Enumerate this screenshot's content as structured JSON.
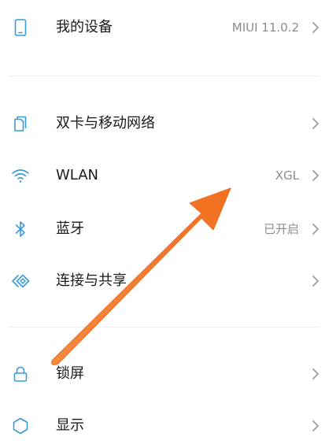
{
  "colors": {
    "icon": "#3a9bd6",
    "text": "#1a1a1a",
    "secondary": "#8c8c8c",
    "chevron": "#9a9a9a",
    "annotation_arrow": "#f47a2c"
  },
  "settings": {
    "my_device": {
      "label": "我的设备",
      "value": "MIUI 11.0.2",
      "icon": "phone-icon"
    },
    "dual_sim": {
      "label": "双卡与移动网络",
      "icon": "sim-card-icon"
    },
    "wlan": {
      "label": "WLAN",
      "value": "XGL",
      "icon": "wifi-icon"
    },
    "bluetooth": {
      "label": "蓝牙",
      "value": "已开启",
      "icon": "bluetooth-icon"
    },
    "connection_sharing": {
      "label": "连接与共享",
      "icon": "connection-icon"
    },
    "lock_screen": {
      "label": "锁屏",
      "icon": "lock-icon"
    },
    "display": {
      "label": "显示",
      "icon": "display-icon"
    }
  }
}
